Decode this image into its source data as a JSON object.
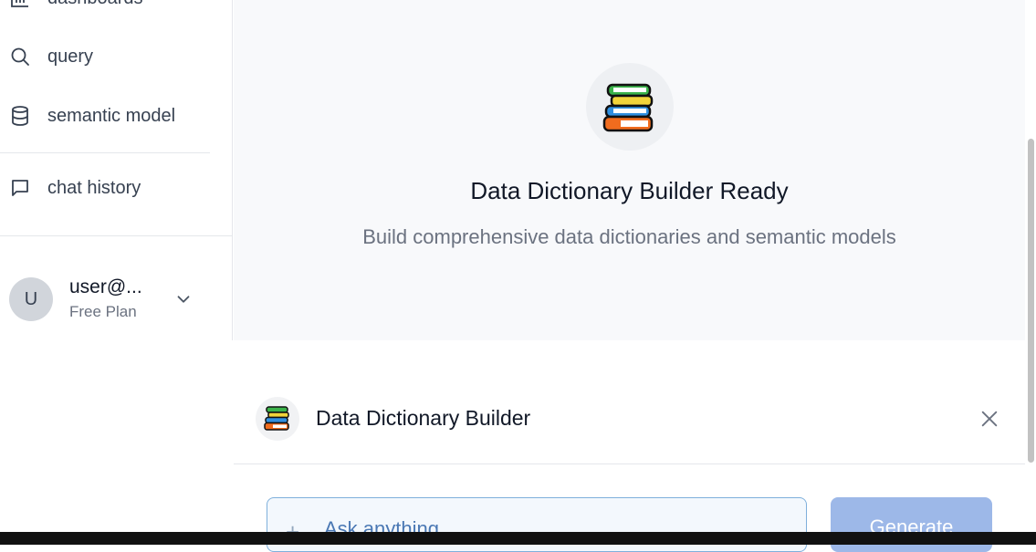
{
  "sidebar": {
    "items": [
      {
        "label": "dashboards",
        "icon": "bar-chart-icon"
      },
      {
        "label": "query",
        "icon": "search-icon"
      },
      {
        "label": "semantic model",
        "icon": "database-icon"
      },
      {
        "label": "chat history",
        "icon": "chat-bubble-icon"
      }
    ],
    "user": {
      "initial": "U",
      "name": "user@...",
      "plan": "Free Plan",
      "icon": "chevron-down-icon"
    }
  },
  "hero": {
    "icon": "books-icon",
    "title": "Data Dictionary Builder Ready",
    "subtitle": "Build comprehensive data dictionaries and semantic models"
  },
  "panel": {
    "icon": "books-icon",
    "title": "Data Dictionary Builder",
    "close_icon": "close-icon",
    "input": {
      "placeholder": "Ask anything",
      "value": ""
    },
    "plus_label": "+",
    "generate_label": "Generate"
  },
  "colors": {
    "accent": "#9db8e8",
    "input_border": "#7fb0dc",
    "hero_bg": "#f8f9fb"
  }
}
